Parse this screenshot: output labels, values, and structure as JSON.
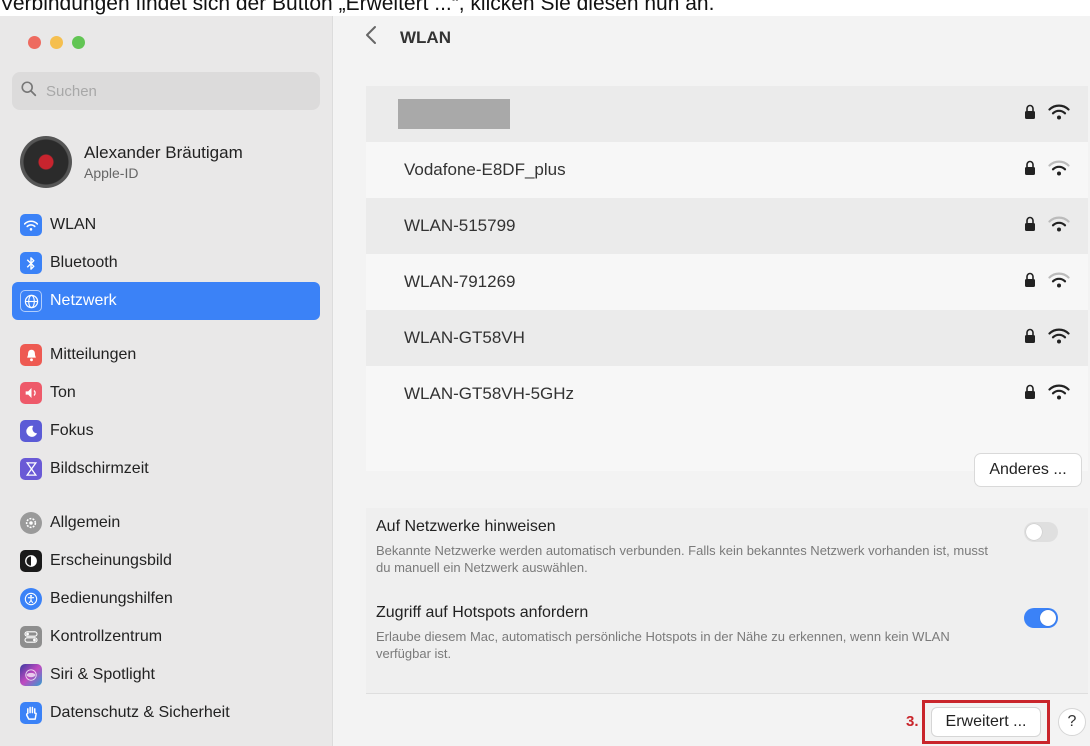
{
  "caption": "Verbindungen findet sich der Button „Erweitert ...“, klicken Sie diesen nun an.",
  "sidebar": {
    "search_placeholder": "Suchen",
    "user": {
      "name": "Alexander Bräutigam",
      "subtitle": "Apple-ID"
    },
    "items": [
      {
        "label": "WLAN",
        "icon": "wifi-icon",
        "color": "#3b82f7"
      },
      {
        "label": "Bluetooth",
        "icon": "bluetooth-icon",
        "color": "#3b82f7"
      },
      {
        "label": "Netzwerk",
        "icon": "globe-icon",
        "color": "#3b82f7",
        "active": true
      },
      {
        "label": "Mitteilungen",
        "icon": "bell-icon",
        "color": "#ee5a52"
      },
      {
        "label": "Ton",
        "icon": "speaker-icon",
        "color": "#ee5a6a"
      },
      {
        "label": "Fokus",
        "icon": "moon-icon",
        "color": "#5b5bd6"
      },
      {
        "label": "Bildschirmzeit",
        "icon": "hourglass-icon",
        "color": "#6a5ad6"
      },
      {
        "label": "Allgemein",
        "icon": "gear-icon",
        "color": "#9a9a9a"
      },
      {
        "label": "Erscheinungsbild",
        "icon": "appearance-icon",
        "color": "#1a1a1a"
      },
      {
        "label": "Bedienungshilfen",
        "icon": "accessibility-icon",
        "color": "#3b82f7"
      },
      {
        "label": "Kontrollzentrum",
        "icon": "toggles-icon",
        "color": "#8e8e8e"
      },
      {
        "label": "Siri & Spotlight",
        "icon": "siri-icon",
        "color": "#5a4ad0"
      },
      {
        "label": "Datenschutz & Sicherheit",
        "icon": "hand-icon",
        "color": "#3b82f7"
      }
    ]
  },
  "main": {
    "title": "WLAN",
    "networks": [
      {
        "name": "",
        "redacted": true
      },
      {
        "name": "Vodafone-E8DF_plus"
      },
      {
        "name": "WLAN-515799"
      },
      {
        "name": "WLAN-791269"
      },
      {
        "name": "WLAN-GT58VH"
      },
      {
        "name": "WLAN-GT58VH-5GHz"
      }
    ],
    "other_button": "Anderes ...",
    "settings": [
      {
        "title": "Auf Netzwerke hinweisen",
        "description": "Bekannte Netzwerke werden automatisch verbunden. Falls kein bekanntes Netzwerk vorhanden ist, musst du manuell ein Netzwerk auswählen.",
        "enabled": false
      },
      {
        "title": "Zugriff auf Hotspots anfordern",
        "description": "Erlaube diesem Mac, automatisch persönliche Hotspots in der Nähe zu erkennen, wenn kein WLAN verfügbar ist.",
        "enabled": true
      }
    ],
    "step_label": "3.",
    "advanced_button": "Erweitert ...",
    "help_button": "?"
  }
}
